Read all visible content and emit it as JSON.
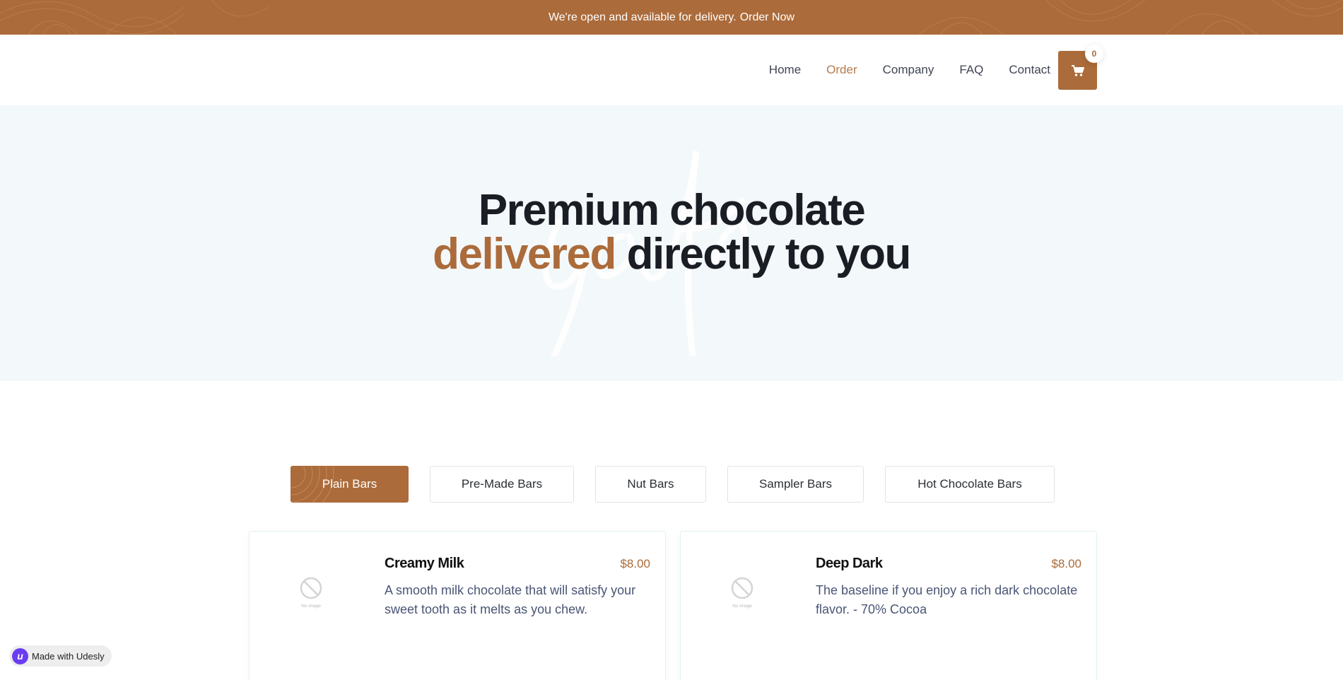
{
  "announcement": {
    "message": "We're open and available for delivery.",
    "link_label": "Order Now"
  },
  "nav": {
    "items": [
      {
        "label": "Home",
        "active": false
      },
      {
        "label": "Order",
        "active": true
      },
      {
        "label": "Company",
        "active": false
      },
      {
        "label": "FAQ",
        "active": false
      },
      {
        "label": "Contact",
        "active": false
      }
    ],
    "cart_count": "0",
    "cart_icon": "cart-icon"
  },
  "hero": {
    "title_line1": "Premium chocolate",
    "title_accent": "delivered",
    "title_rest": " directly to you"
  },
  "tabs": [
    {
      "label": "Plain Bars",
      "active": true
    },
    {
      "label": "Pre-Made Bars",
      "active": false
    },
    {
      "label": "Nut Bars",
      "active": false
    },
    {
      "label": "Sampler Bars",
      "active": false
    },
    {
      "label": "Hot Chocolate Bars",
      "active": false
    }
  ],
  "products": [
    {
      "name": "Creamy Milk",
      "price": "$8.00",
      "description": "A smooth milk chocolate that will satisfy your sweet tooth as it melts as you chew.",
      "image_placeholder": "No image"
    },
    {
      "name": "Deep Dark",
      "price": "$8.00",
      "description": "The baseline if you enjoy a rich dark chocolate flavor. - 70% Cocoa",
      "image_placeholder": "No image"
    }
  ],
  "badge": {
    "logo_letter": "u",
    "label": "Made with Udesly"
  },
  "colors": {
    "brand": "#ab6b3a",
    "hero_bg": "#f3f8fb",
    "nav_active": "#b57a4b",
    "text_dark": "#1a1d23",
    "desc_text": "#4a5575"
  }
}
